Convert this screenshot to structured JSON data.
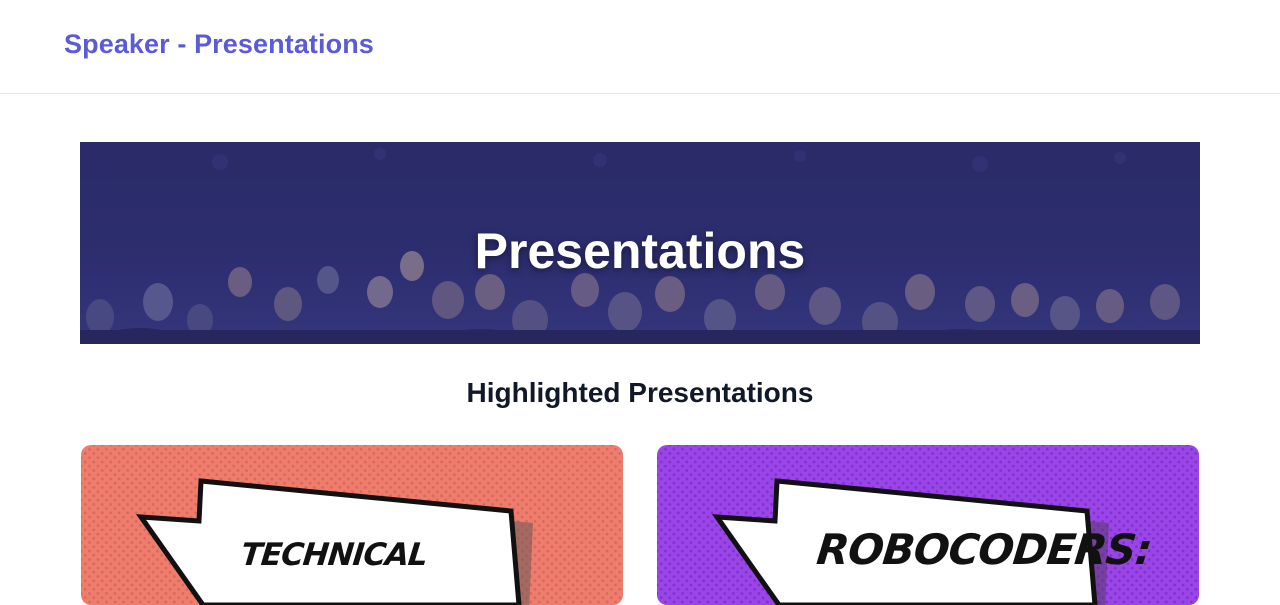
{
  "header": {
    "site_title": "Speaker - Presentations"
  },
  "hero": {
    "title": "Presentations"
  },
  "highlighted": {
    "heading": "Highlighted Presentations",
    "cards": [
      {
        "bubble_text": "TECHNICAL",
        "background": "#ee7d6d"
      },
      {
        "bubble_text": "ROBOCODERS:",
        "background": "#9a45e8"
      }
    ]
  },
  "colors": {
    "brand": "#5b5bd6",
    "hero_overlay": "#2b2c6b"
  }
}
